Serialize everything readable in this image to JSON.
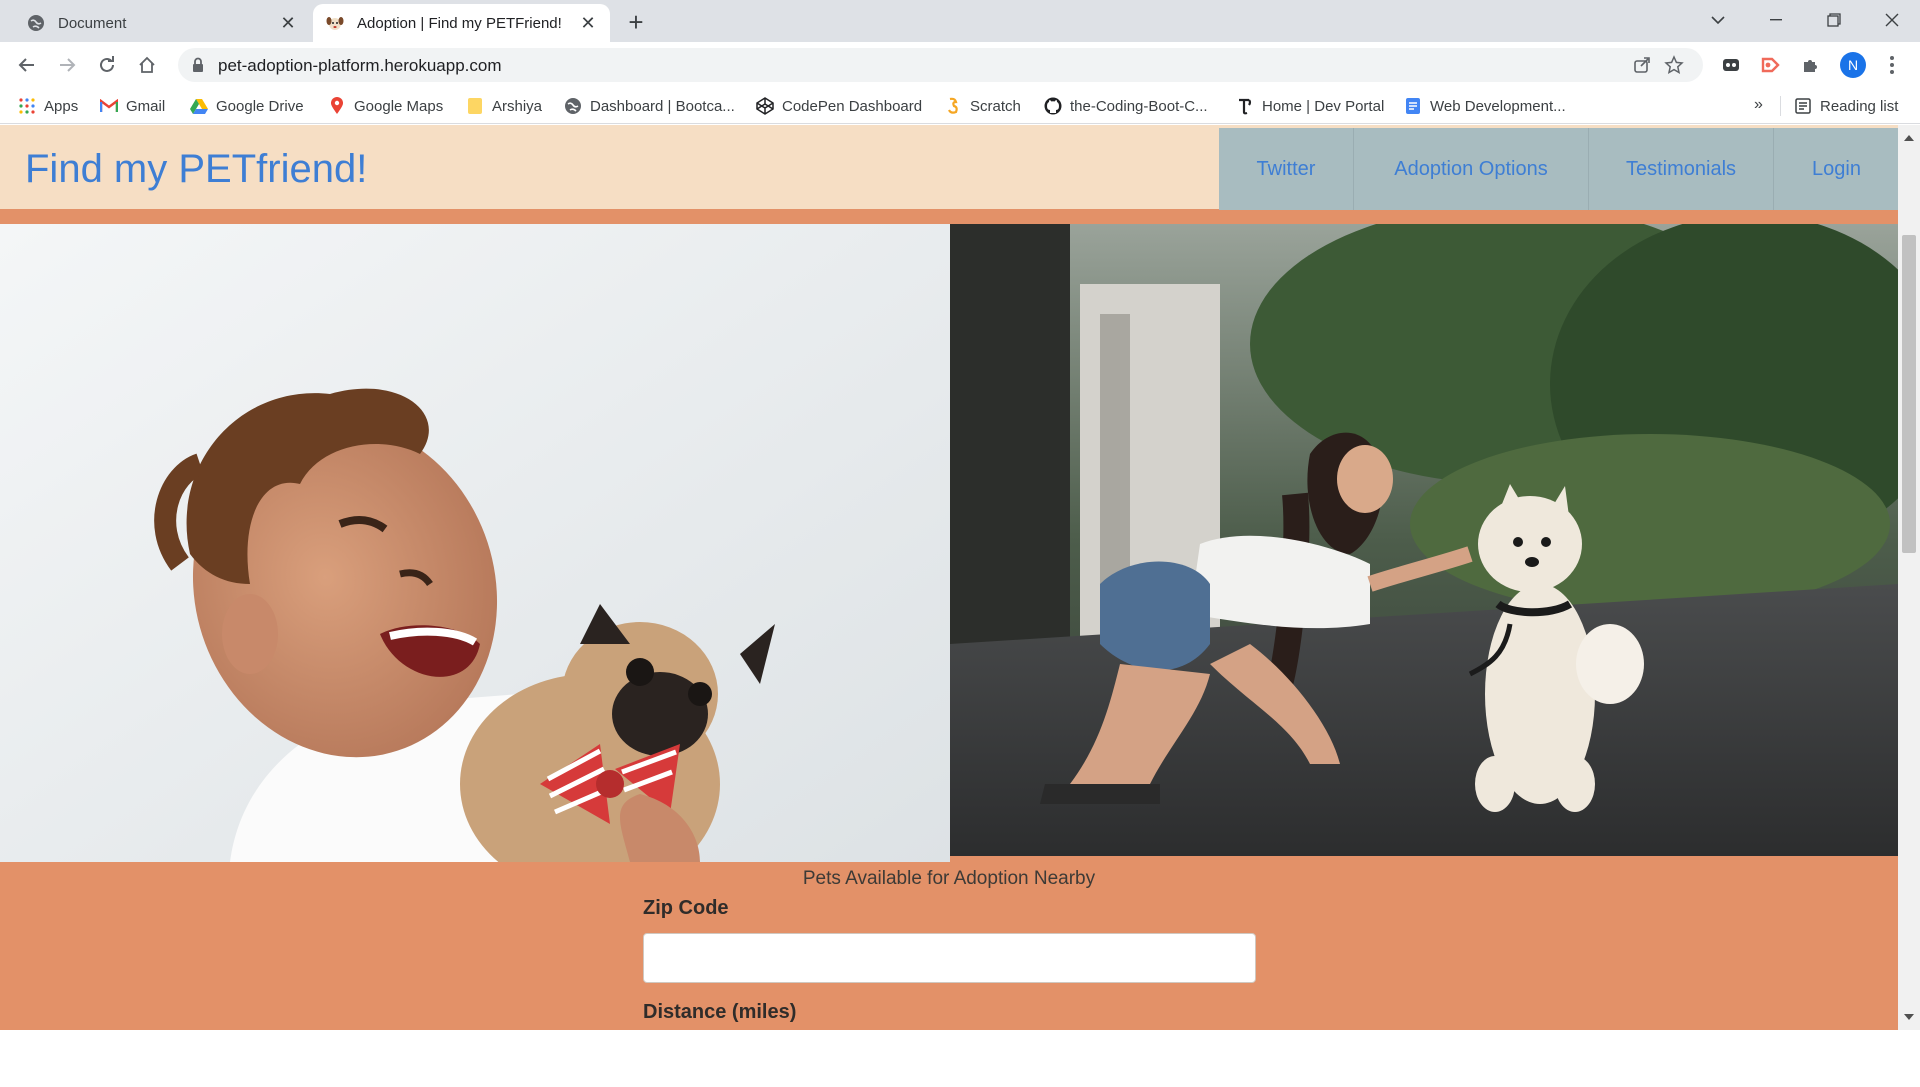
{
  "browser": {
    "tabs": [
      {
        "title": "Document",
        "active": false,
        "icon": "globe-icon"
      },
      {
        "title": "Adoption | Find my PETFriend!",
        "active": true,
        "icon": "dog-favicon-icon"
      }
    ],
    "url": "pet-adoption-platform.herokuapp.com",
    "profile_initial": "N",
    "bookmarks": [
      {
        "label": "Apps",
        "icon": "apps-grid-icon"
      },
      {
        "label": "Gmail",
        "icon": "gmail-icon"
      },
      {
        "label": "Google Drive",
        "icon": "drive-icon"
      },
      {
        "label": "Google Maps",
        "icon": "maps-pin-icon"
      },
      {
        "label": "Arshiya",
        "icon": "folder-icon"
      },
      {
        "label": "Dashboard | Bootca...",
        "icon": "globe-icon"
      },
      {
        "label": "CodePen Dashboard",
        "icon": "codepen-icon"
      },
      {
        "label": "Scratch",
        "icon": "scratch-icon"
      },
      {
        "label": "the-Coding-Boot-C...",
        "icon": "github-icon"
      },
      {
        "label": "Home | Dev Portal",
        "icon": "devportal-icon"
      },
      {
        "label": "Web Development...",
        "icon": "docs-icon"
      }
    ],
    "bookmarks_overflow": "»",
    "reading_list": "Reading list"
  },
  "site": {
    "brand": "Find my PETfriend!",
    "nav": [
      {
        "label": "Twitter"
      },
      {
        "label": "Adoption Options"
      },
      {
        "label": "Testimonials"
      },
      {
        "label": "Login"
      }
    ],
    "hero_images": [
      {
        "name": "boy-with-pug-photo"
      },
      {
        "name": "woman-kissing-pomeranian-photo"
      }
    ],
    "section_caption": "Pets Available for Adoption Nearby",
    "form": {
      "zip_label": "Zip Code",
      "zip_value": "",
      "distance_label": "Distance (miles)"
    }
  },
  "colors": {
    "header_bg": "#f6dec4",
    "brand_text": "#3e7ed4",
    "nav_bg": "#a8bcc0",
    "page_bg": "#e39168"
  }
}
